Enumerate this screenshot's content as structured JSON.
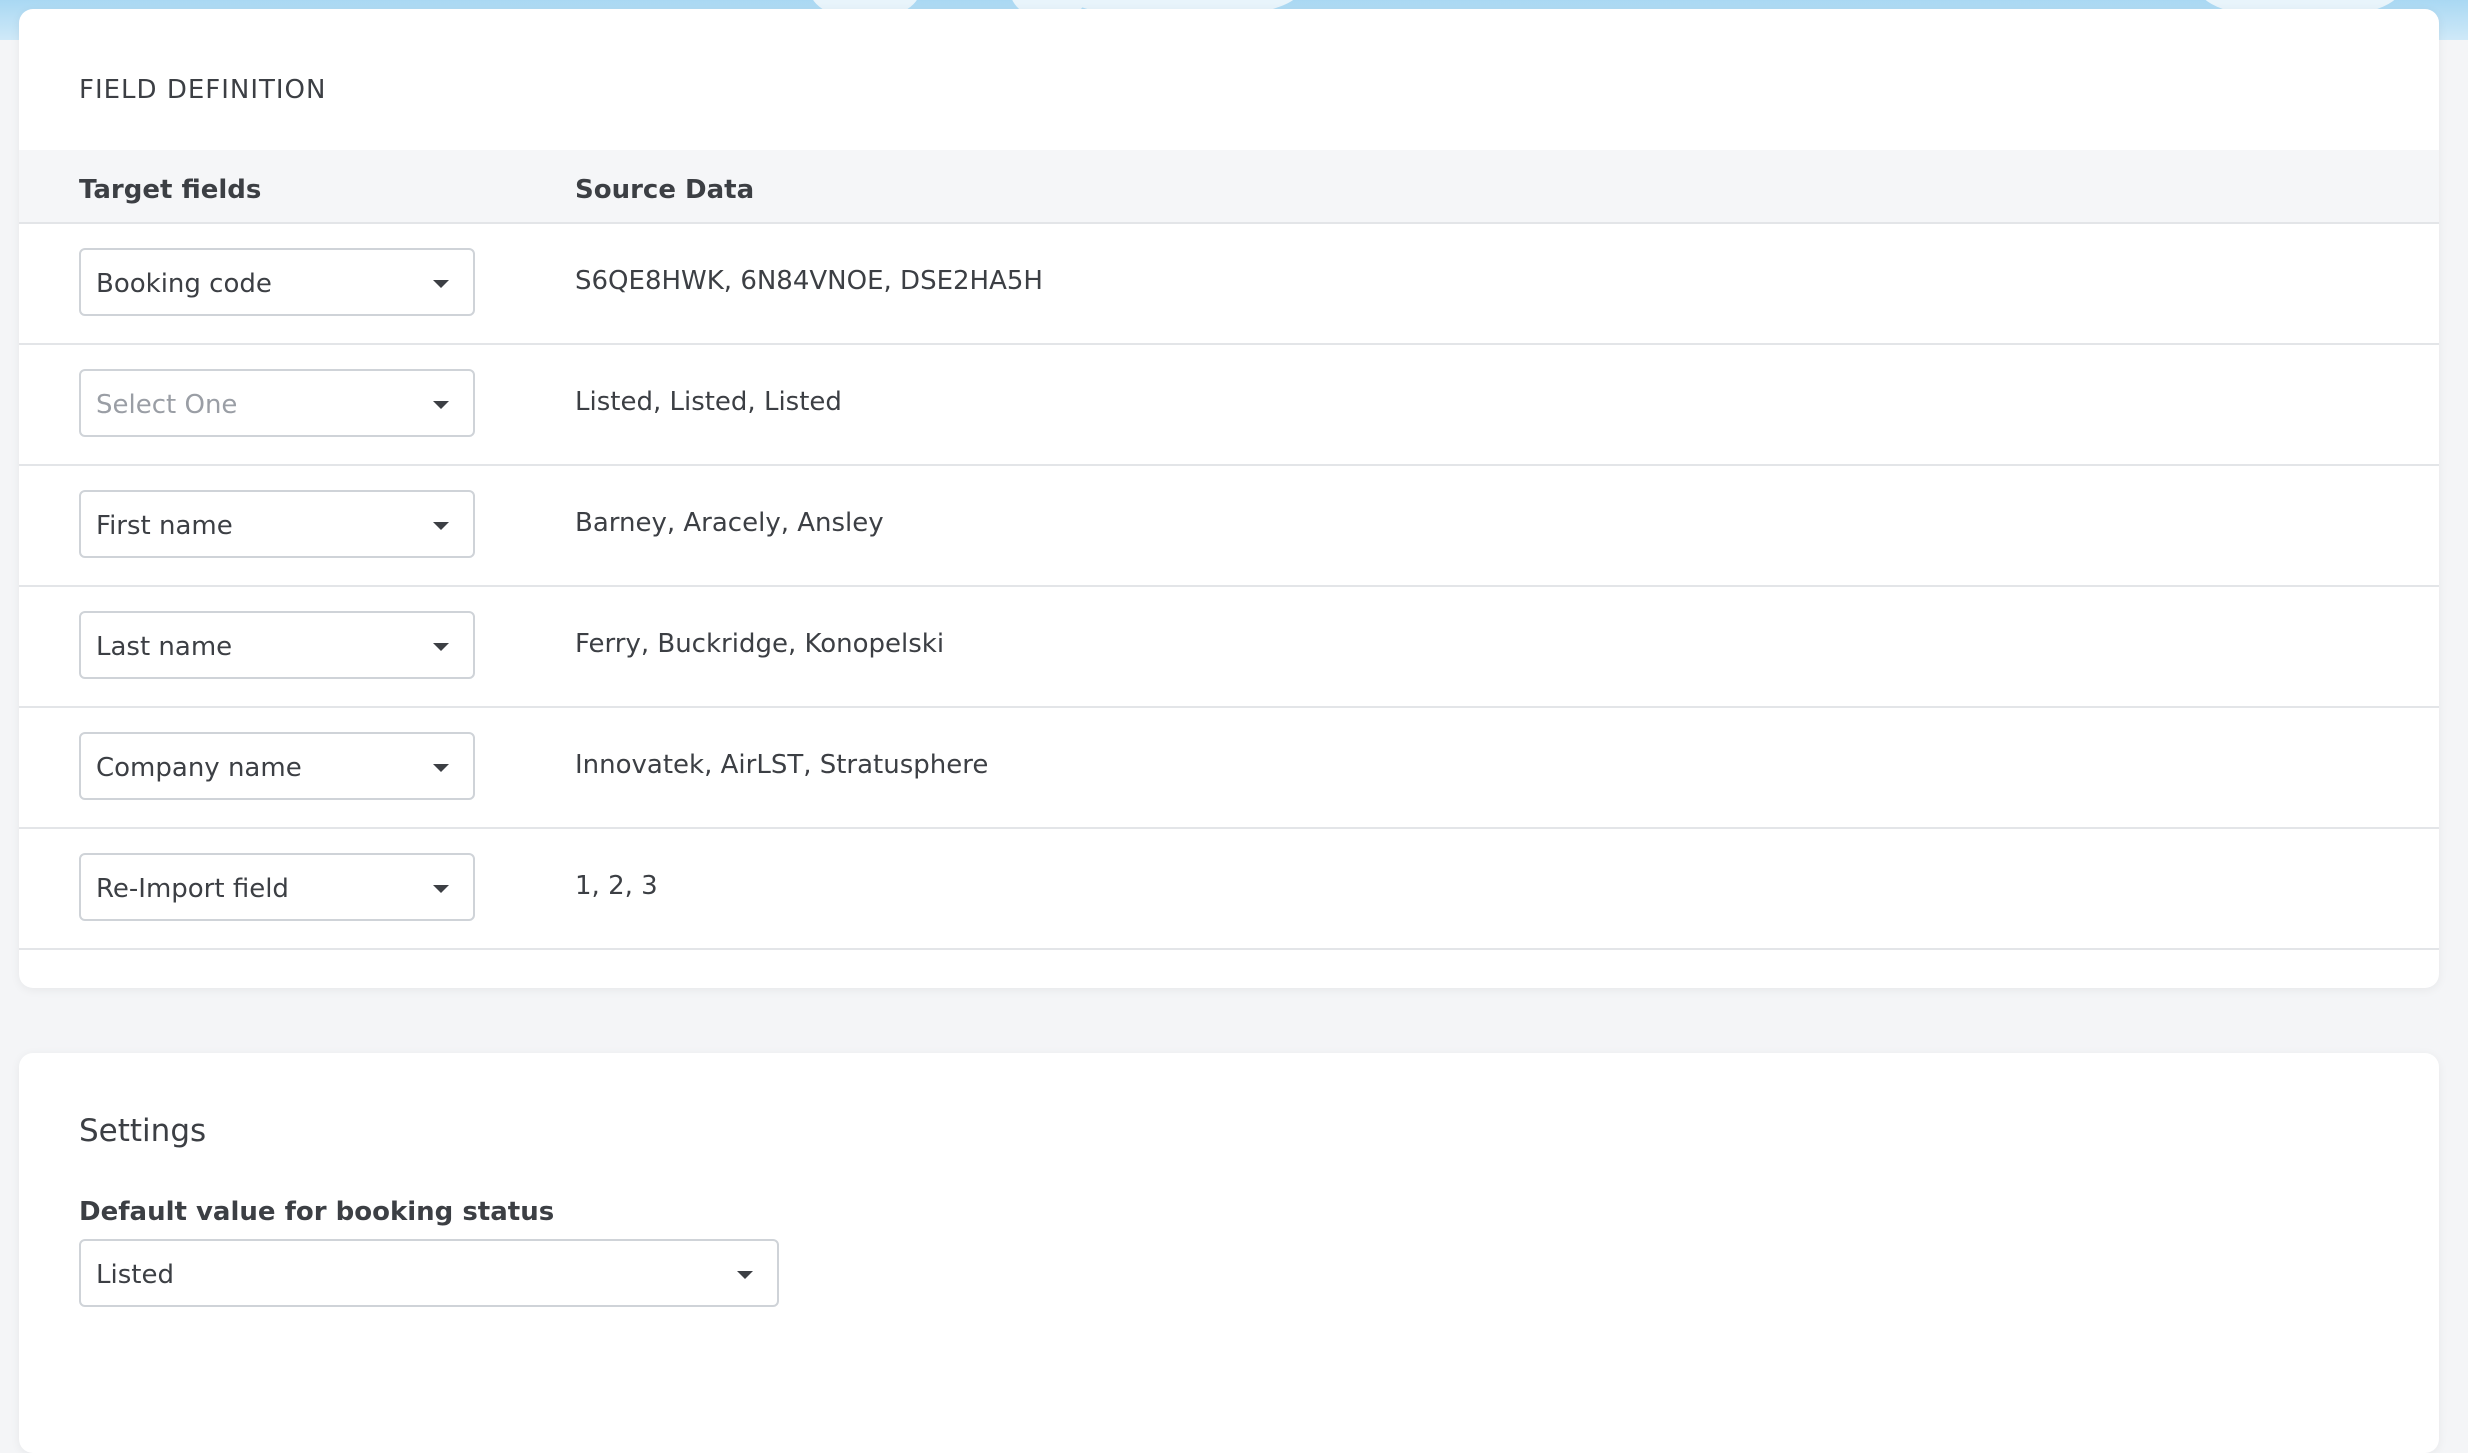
{
  "field_definition": {
    "title": "FIELD DEFINITION",
    "columns": {
      "target": "Target fields",
      "source": "Source Data"
    },
    "rows": [
      {
        "target": "Booking code",
        "placeholder": false,
        "source": "S6QE8HWK, 6N84VNOE, DSE2HA5H"
      },
      {
        "target": "Select One",
        "placeholder": true,
        "source": "Listed, Listed, Listed"
      },
      {
        "target": "First name",
        "placeholder": false,
        "source": "Barney, Aracely, Ansley"
      },
      {
        "target": "Last name",
        "placeholder": false,
        "source": "Ferry, Buckridge, Konopelski"
      },
      {
        "target": "Company name",
        "placeholder": false,
        "source": "Innovatek, AirLST, Stratusphere"
      },
      {
        "target": "Re-Import field",
        "placeholder": false,
        "source": "1, 2, 3"
      }
    ]
  },
  "settings": {
    "title": "Settings",
    "default_status_label": "Default value for booking status",
    "default_status_value": "Listed"
  },
  "icons": {
    "dropdown": "caret-down-icon"
  },
  "colors": {
    "text": "#3c3f44",
    "placeholder": "#9a9ea5",
    "border": "#cfd3d8",
    "header_bg": "#f5f6f8"
  }
}
